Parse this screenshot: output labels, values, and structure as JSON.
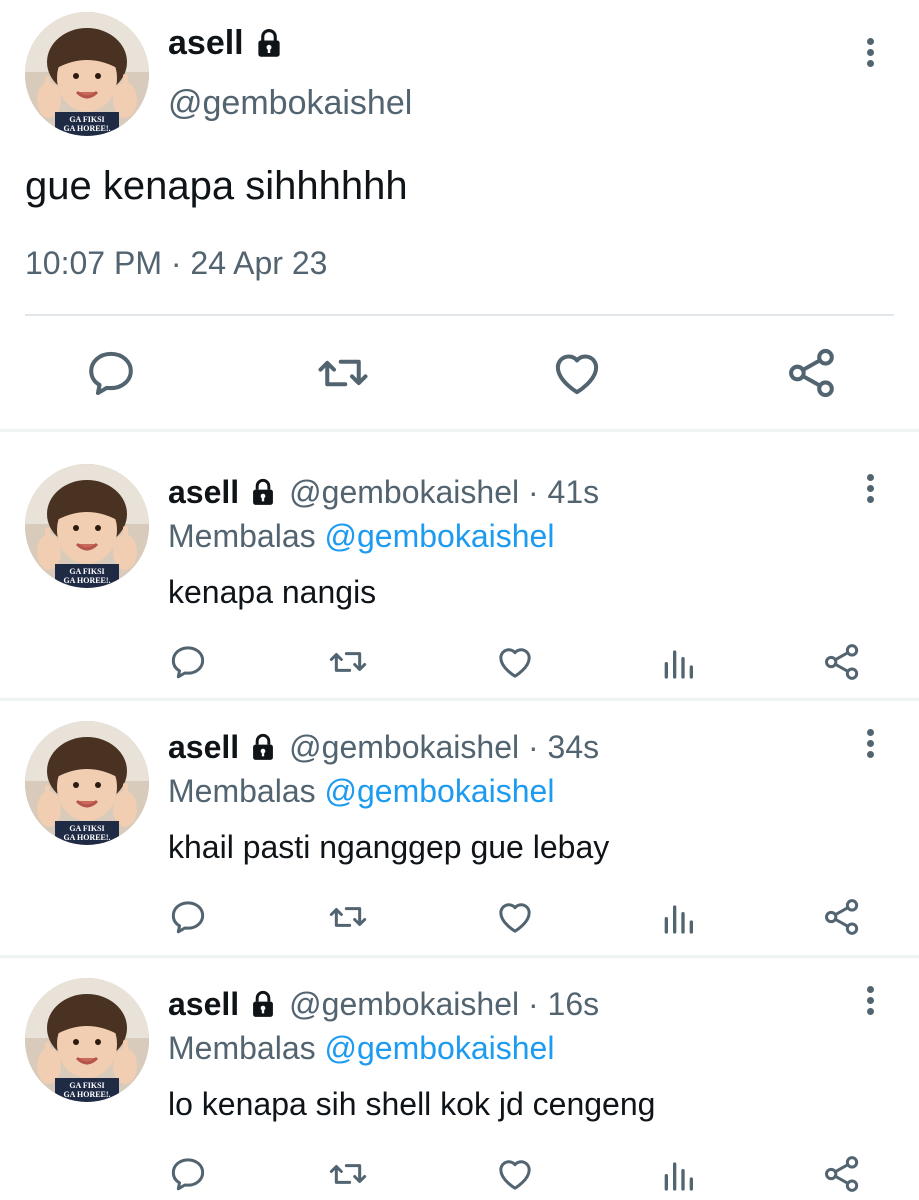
{
  "main_tweet": {
    "name": "asell",
    "handle": "@gembokaishel",
    "text": "gue kenapa sihhhhhh",
    "timestamp": "10:07 PM · 24 Apr 23",
    "avatar_caption_1": "GA FIKSI",
    "avatar_caption_2": "GA HOREE!.",
    "actions": [
      "reply-icon",
      "retweet-icon",
      "like-icon",
      "share-icon"
    ]
  },
  "replies": [
    {
      "name": "asell",
      "handle_time": "@gembokaishel · 41s",
      "replying_label": "Membalas",
      "replying_to": "@gembokaishel",
      "text": "kenapa nangis"
    },
    {
      "name": "asell",
      "handle_time": "@gembokaishel · 34s",
      "replying_label": "Membalas",
      "replying_to": "@gembokaishel",
      "text": "khail pasti nganggep gue lebay"
    },
    {
      "name": "asell",
      "handle_time": "@gembokaishel · 16s",
      "replying_label": "Membalas",
      "replying_to": "@gembokaishel",
      "text": "lo kenapa sih shell kok jd cengeng"
    }
  ],
  "reply_actions": [
    "reply-icon",
    "retweet-icon",
    "like-icon",
    "views-icon",
    "share-icon"
  ],
  "colors": {
    "text": "#0f1419",
    "secondary": "#536471",
    "mention": "#1d9bf0",
    "divider": "#eff3f4"
  }
}
